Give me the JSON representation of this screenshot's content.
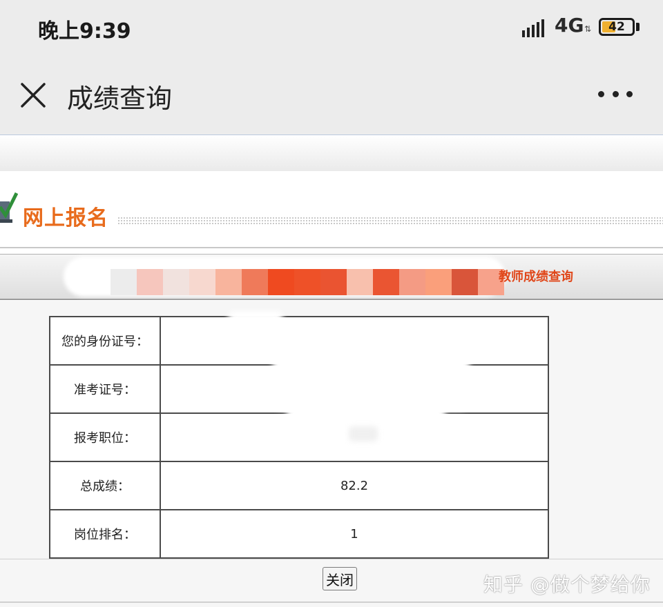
{
  "status_bar": {
    "time": "晚上9:39",
    "network": "4G",
    "battery_level": "42",
    "battery_color": "#f0b030"
  },
  "title_bar": {
    "title": "成绩查询",
    "close_icon": "close-icon",
    "more_icon": "more-dots-icon"
  },
  "site": {
    "logo_text": "网上报名",
    "logo_icon": "checkmark-icon",
    "nav_link": "教师成绩查询",
    "accent_color": "#e86b1c",
    "link_color": "#e0471a"
  },
  "score_table": {
    "rows": [
      {
        "label": "您的身份证号：",
        "value": ""
      },
      {
        "label": "准考证号：",
        "value": ""
      },
      {
        "label": "报考职位：",
        "value": ""
      },
      {
        "label": "总成绩：",
        "value": "82.2"
      },
      {
        "label": "岗位排名：",
        "value": "1"
      }
    ]
  },
  "close_button_label": "关闭",
  "watermark": "知乎 @做个梦给你"
}
